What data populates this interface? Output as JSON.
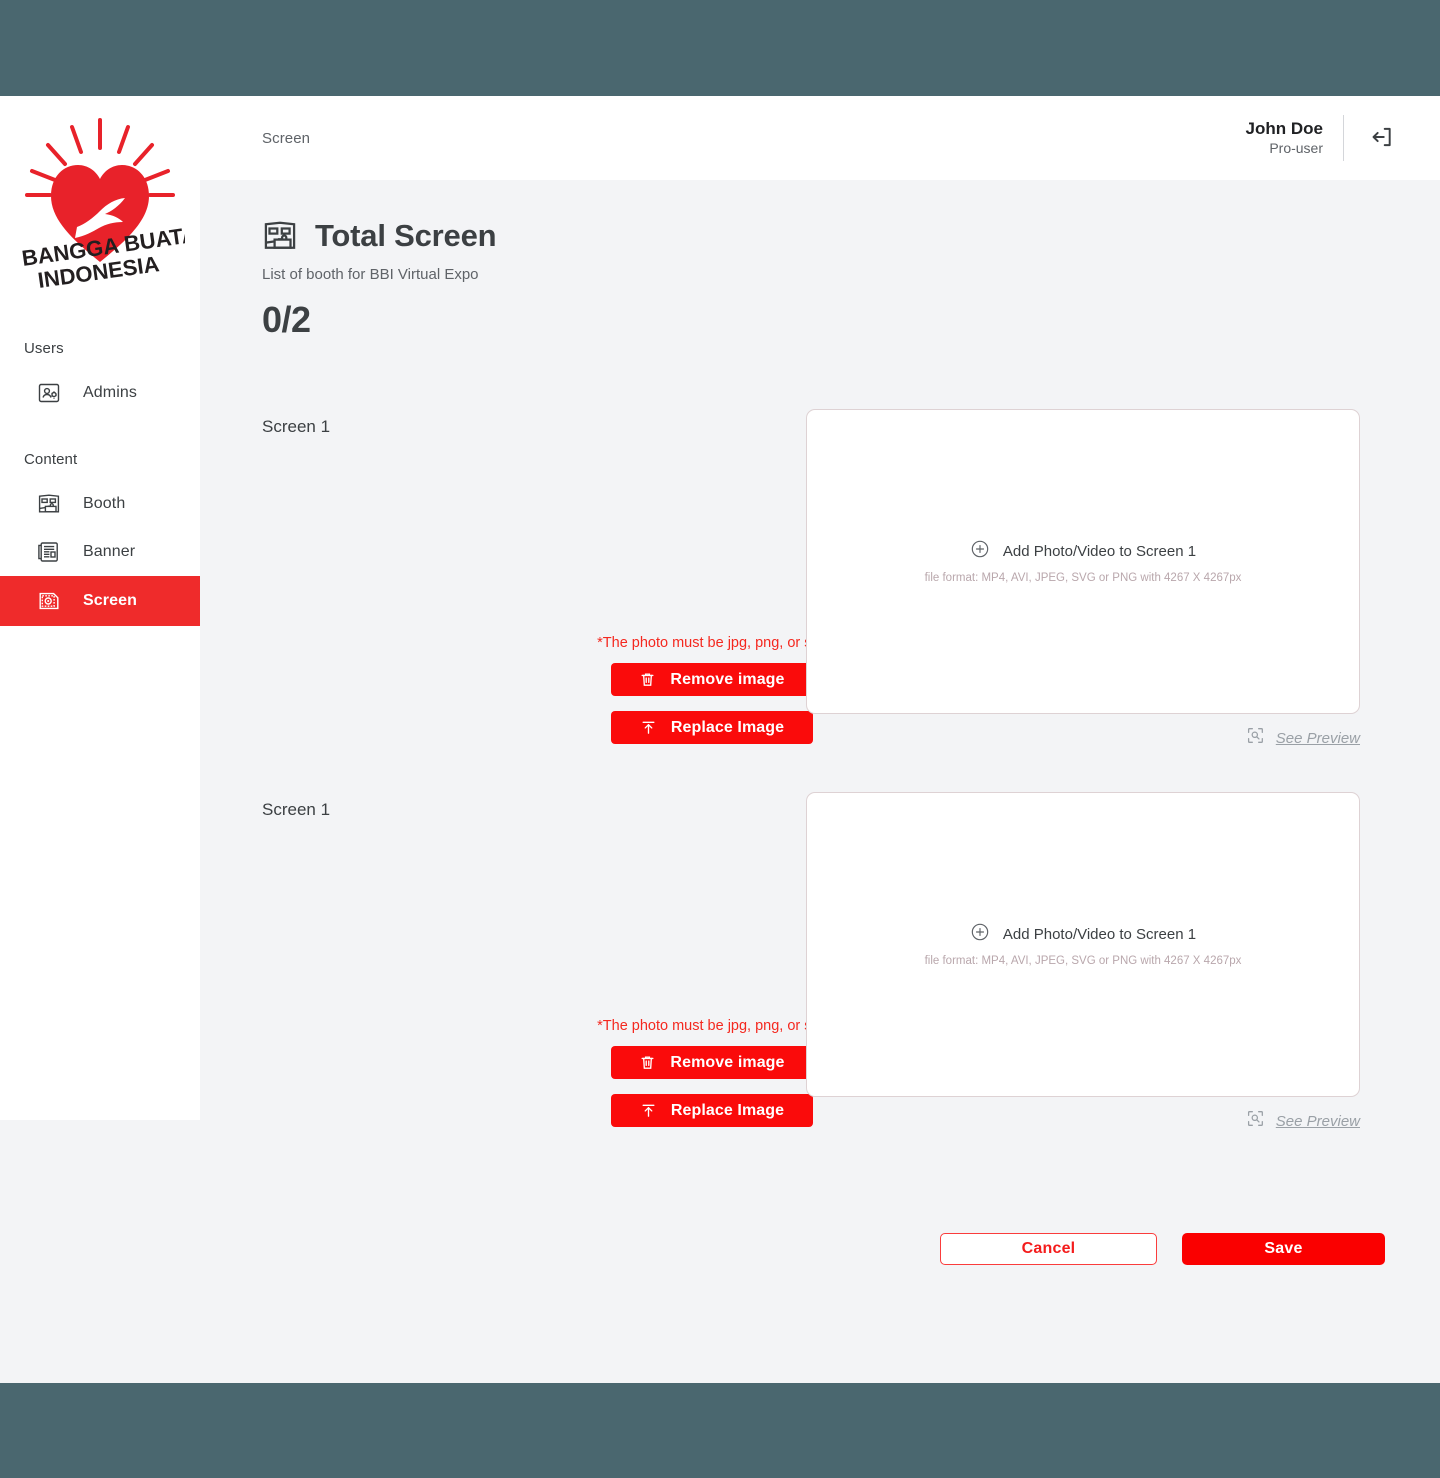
{
  "theme": {
    "frame_color": "#4a676f",
    "page_bg": "#f3f4f6",
    "accent_red": "#fa0b0b",
    "sidebar_active_red": "#ef2b2b",
    "save_red": "#fa0000",
    "text_dark": "#3c4043",
    "text_muted": "#5f6368"
  },
  "sidebar": {
    "logo": {
      "icon": "bbi-heart-logo",
      "line1": "BANGGA BUATAN",
      "line2": "INDONESIA"
    },
    "groups": [
      {
        "label": "Users",
        "items": [
          {
            "label": "Admins",
            "icon": "admins-icon",
            "active": false
          }
        ]
      },
      {
        "label": "Content",
        "items": [
          {
            "label": "Booth",
            "icon": "booth-icon",
            "active": false
          },
          {
            "label": "Banner",
            "icon": "banner-icon",
            "active": false
          },
          {
            "label": "Screen",
            "icon": "screen-icon",
            "active": true
          }
        ]
      }
    ]
  },
  "header": {
    "breadcrumb": "Screen",
    "user_name": "John Doe",
    "user_role": "Pro-user",
    "logout_icon": "logout-icon"
  },
  "page": {
    "icon": "total-screen-icon",
    "title": "Total Screen",
    "subtitle": "List of booth for BBI Virtual Expo",
    "count": "0/2"
  },
  "screens": [
    {
      "label": "Screen 1",
      "hint": "*The photo must be jpg, png, or svg",
      "remove_label": "Remove image",
      "replace_label": "Replace Image",
      "remove_icon": "trash-icon",
      "replace_icon": "upload-icon",
      "drop_title": "Add Photo/Video to Screen 1",
      "drop_sub": "file format: MP4, AVI, JPEG, SVG or PNG with 4267 X 4267px",
      "drop_icon": "plus-circle-icon",
      "preview_label": "See Preview",
      "preview_icon": "scan-search-icon"
    },
    {
      "label": "Screen 1",
      "hint": "*The photo must be jpg, png, or svg",
      "remove_label": "Remove image",
      "replace_label": "Replace Image",
      "remove_icon": "trash-icon",
      "replace_icon": "upload-icon",
      "drop_title": "Add Photo/Video to Screen 1",
      "drop_sub": "file format: MP4, AVI, JPEG, SVG or PNG with 4267 X 4267px",
      "drop_icon": "plus-circle-icon",
      "preview_label": "See Preview",
      "preview_icon": "scan-search-icon"
    }
  ],
  "footer": {
    "cancel_label": "Cancel",
    "save_label": "Save"
  }
}
